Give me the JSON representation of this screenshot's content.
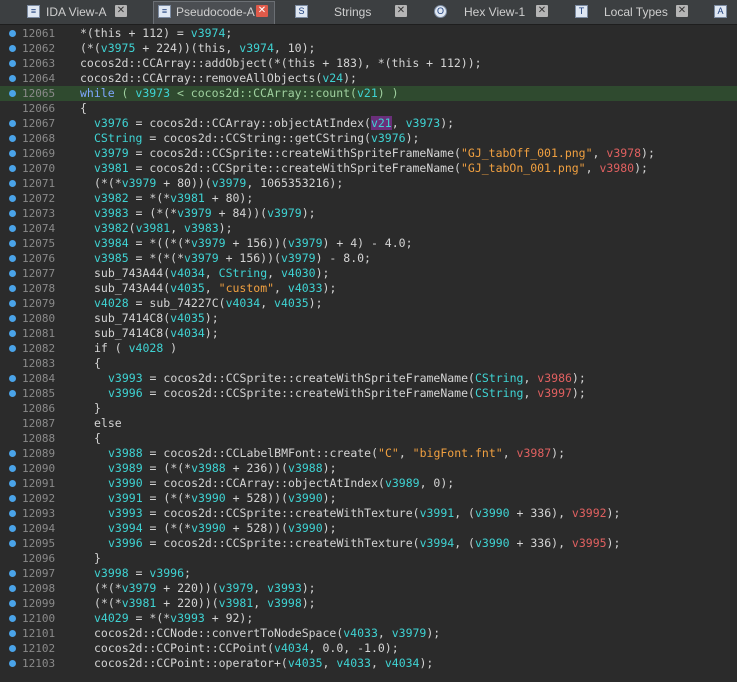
{
  "tabs": [
    {
      "label": "IDA View-A",
      "icon": "disassembly-view-icon",
      "active": false
    },
    {
      "label": "Pseudocode-A",
      "icon": "pseudocode-icon",
      "active": true
    },
    {
      "label": "Strings",
      "icon": "strings-icon",
      "active": false
    },
    {
      "label": "Hex View-1",
      "icon": "hex-view-icon",
      "active": false
    },
    {
      "label": "Local Types",
      "icon": "local-types-icon",
      "active": false
    }
  ],
  "colors": {
    "background": "#2b2b2b",
    "line_number": "#8a8a8a",
    "variable": "#3fd3d3",
    "string": "#f0a040",
    "red_variable": "#e06060",
    "highlight": "#2f4a2f",
    "breakpoint_dot": "#4aa3e8"
  },
  "code_lines": [
    {
      "num": "12061",
      "dot": true,
      "indent": 0,
      "tokens": [
        [
          "t",
          "*(this + 112) = "
        ],
        [
          "v",
          "v3974"
        ],
        [
          "t",
          ";"
        ]
      ]
    },
    {
      "num": "12062",
      "dot": true,
      "indent": 0,
      "tokens": [
        [
          "t",
          "(*("
        ],
        [
          "v",
          "v3975"
        ],
        [
          "t",
          " + 224))(this, "
        ],
        [
          "v",
          "v3974"
        ],
        [
          "t",
          ", 10);"
        ]
      ]
    },
    {
      "num": "12063",
      "dot": true,
      "indent": 0,
      "tokens": [
        [
          "t",
          "cocos2d::CCArray::addObject(*(this + 183), *(this + 112));"
        ]
      ]
    },
    {
      "num": "12064",
      "dot": true,
      "indent": 0,
      "tokens": [
        [
          "t",
          "cocos2d::CCArray::removeAllObjects("
        ],
        [
          "v",
          "v24"
        ],
        [
          "t",
          ");"
        ]
      ]
    },
    {
      "num": "12065",
      "dot": true,
      "indent": 0,
      "hl": true,
      "tokens": [
        [
          "k",
          "while"
        ],
        [
          "t",
          " ( "
        ],
        [
          "v",
          "v3973"
        ],
        [
          "t",
          " < cocos2d::CCArray::count("
        ],
        [
          "v",
          "v21"
        ],
        [
          "t",
          ") )"
        ]
      ]
    },
    {
      "num": "12066",
      "dot": false,
      "indent": 0,
      "tokens": [
        [
          "t",
          "{"
        ]
      ]
    },
    {
      "num": "12067",
      "dot": true,
      "indent": 1,
      "tokens": [
        [
          "v",
          "v3976"
        ],
        [
          "t",
          " = cocos2d::CCArray::objectAtIndex("
        ],
        [
          "sel",
          "v21"
        ],
        [
          "t",
          ", "
        ],
        [
          "v",
          "v3973"
        ],
        [
          "t",
          ");"
        ]
      ]
    },
    {
      "num": "12068",
      "dot": true,
      "indent": 1,
      "tokens": [
        [
          "v",
          "CString"
        ],
        [
          "t",
          " = cocos2d::CCString::getCString("
        ],
        [
          "v",
          "v3976"
        ],
        [
          "t",
          ");"
        ]
      ]
    },
    {
      "num": "12069",
      "dot": true,
      "indent": 1,
      "tokens": [
        [
          "v",
          "v3979"
        ],
        [
          "t",
          " = cocos2d::CCSprite::createWithSpriteFrameName("
        ],
        [
          "s",
          "\"GJ_tabOff_001.png\""
        ],
        [
          "t",
          ", "
        ],
        [
          "n",
          "v3978"
        ],
        [
          "t",
          ");"
        ]
      ]
    },
    {
      "num": "12070",
      "dot": true,
      "indent": 1,
      "tokens": [
        [
          "v",
          "v3981"
        ],
        [
          "t",
          " = cocos2d::CCSprite::createWithSpriteFrameName("
        ],
        [
          "s",
          "\"GJ_tabOn_001.png\""
        ],
        [
          "t",
          ", "
        ],
        [
          "n",
          "v3980"
        ],
        [
          "t",
          ");"
        ]
      ]
    },
    {
      "num": "12071",
      "dot": true,
      "indent": 1,
      "tokens": [
        [
          "t",
          "(*(*"
        ],
        [
          "v",
          "v3979"
        ],
        [
          "t",
          " + 80))("
        ],
        [
          "v",
          "v3979"
        ],
        [
          "t",
          ", 1065353216);"
        ]
      ]
    },
    {
      "num": "12072",
      "dot": true,
      "indent": 1,
      "tokens": [
        [
          "v",
          "v3982"
        ],
        [
          "t",
          " = *(*"
        ],
        [
          "v",
          "v3981"
        ],
        [
          "t",
          " + 80);"
        ]
      ]
    },
    {
      "num": "12073",
      "dot": true,
      "indent": 1,
      "tokens": [
        [
          "v",
          "v3983"
        ],
        [
          "t",
          " = (*(*"
        ],
        [
          "v",
          "v3979"
        ],
        [
          "t",
          " + 84))("
        ],
        [
          "v",
          "v3979"
        ],
        [
          "t",
          ");"
        ]
      ]
    },
    {
      "num": "12074",
      "dot": true,
      "indent": 1,
      "tokens": [
        [
          "v",
          "v3982"
        ],
        [
          "t",
          "("
        ],
        [
          "v",
          "v3981"
        ],
        [
          "t",
          ", "
        ],
        [
          "v",
          "v3983"
        ],
        [
          "t",
          ");"
        ]
      ]
    },
    {
      "num": "12075",
      "dot": true,
      "indent": 1,
      "tokens": [
        [
          "v",
          "v3984"
        ],
        [
          "t",
          " = *((*(*"
        ],
        [
          "v",
          "v3979"
        ],
        [
          "t",
          " + 156))("
        ],
        [
          "v",
          "v3979"
        ],
        [
          "t",
          ") + 4) - 4.0;"
        ]
      ]
    },
    {
      "num": "12076",
      "dot": true,
      "indent": 1,
      "tokens": [
        [
          "v",
          "v3985"
        ],
        [
          "t",
          " = *(*(*"
        ],
        [
          "v",
          "v3979"
        ],
        [
          "t",
          " + 156))("
        ],
        [
          "v",
          "v3979"
        ],
        [
          "t",
          ") - 8.0;"
        ]
      ]
    },
    {
      "num": "12077",
      "dot": true,
      "indent": 1,
      "tokens": [
        [
          "t",
          "sub_743A44("
        ],
        [
          "v",
          "v4034"
        ],
        [
          "t",
          ", "
        ],
        [
          "v",
          "CString"
        ],
        [
          "t",
          ", "
        ],
        [
          "v",
          "v4030"
        ],
        [
          "t",
          ");"
        ]
      ]
    },
    {
      "num": "12078",
      "dot": true,
      "indent": 1,
      "tokens": [
        [
          "t",
          "sub_743A44("
        ],
        [
          "v",
          "v4035"
        ],
        [
          "t",
          ", "
        ],
        [
          "s",
          "\"custom\""
        ],
        [
          "t",
          ", "
        ],
        [
          "v",
          "v4033"
        ],
        [
          "t",
          ");"
        ]
      ]
    },
    {
      "num": "12079",
      "dot": true,
      "indent": 1,
      "tokens": [
        [
          "v",
          "v4028"
        ],
        [
          "t",
          " = sub_74227C("
        ],
        [
          "v",
          "v4034"
        ],
        [
          "t",
          ", "
        ],
        [
          "v",
          "v4035"
        ],
        [
          "t",
          ");"
        ]
      ]
    },
    {
      "num": "12080",
      "dot": true,
      "indent": 1,
      "tokens": [
        [
          "t",
          "sub_7414C8("
        ],
        [
          "v",
          "v4035"
        ],
        [
          "t",
          ");"
        ]
      ]
    },
    {
      "num": "12081",
      "dot": true,
      "indent": 1,
      "tokens": [
        [
          "t",
          "sub_7414C8("
        ],
        [
          "v",
          "v4034"
        ],
        [
          "t",
          ");"
        ]
      ]
    },
    {
      "num": "12082",
      "dot": true,
      "indent": 1,
      "tokens": [
        [
          "t",
          "if ( "
        ],
        [
          "v",
          "v4028"
        ],
        [
          "t",
          " )"
        ]
      ]
    },
    {
      "num": "12083",
      "dot": false,
      "indent": 1,
      "tokens": [
        [
          "t",
          "{"
        ]
      ]
    },
    {
      "num": "12084",
      "dot": true,
      "indent": 2,
      "tokens": [
        [
          "v",
          "v3993"
        ],
        [
          "t",
          " = cocos2d::CCSprite::createWithSpriteFrameName("
        ],
        [
          "v",
          "CString"
        ],
        [
          "t",
          ", "
        ],
        [
          "n",
          "v3986"
        ],
        [
          "t",
          ");"
        ]
      ]
    },
    {
      "num": "12085",
      "dot": true,
      "indent": 2,
      "tokens": [
        [
          "v",
          "v3996"
        ],
        [
          "t",
          " = cocos2d::CCSprite::createWithSpriteFrameName("
        ],
        [
          "v",
          "CString"
        ],
        [
          "t",
          ", "
        ],
        [
          "n",
          "v3997"
        ],
        [
          "t",
          ");"
        ]
      ]
    },
    {
      "num": "12086",
      "dot": false,
      "indent": 1,
      "tokens": [
        [
          "t",
          "}"
        ]
      ]
    },
    {
      "num": "12087",
      "dot": false,
      "indent": 1,
      "tokens": [
        [
          "t",
          "else"
        ]
      ]
    },
    {
      "num": "12088",
      "dot": false,
      "indent": 1,
      "tokens": [
        [
          "t",
          "{"
        ]
      ]
    },
    {
      "num": "12089",
      "dot": true,
      "indent": 2,
      "tokens": [
        [
          "v",
          "v3988"
        ],
        [
          "t",
          " = cocos2d::CCLabelBMFont::create("
        ],
        [
          "s",
          "\"C\""
        ],
        [
          "t",
          ", "
        ],
        [
          "s",
          "\"bigFont.fnt\""
        ],
        [
          "t",
          ", "
        ],
        [
          "n",
          "v3987"
        ],
        [
          "t",
          ");"
        ]
      ]
    },
    {
      "num": "12090",
      "dot": true,
      "indent": 2,
      "tokens": [
        [
          "v",
          "v3989"
        ],
        [
          "t",
          " = (*(*"
        ],
        [
          "v",
          "v3988"
        ],
        [
          "t",
          " + 236))("
        ],
        [
          "v",
          "v3988"
        ],
        [
          "t",
          ");"
        ]
      ]
    },
    {
      "num": "12091",
      "dot": true,
      "indent": 2,
      "tokens": [
        [
          "v",
          "v3990"
        ],
        [
          "t",
          " = cocos2d::CCArray::objectAtIndex("
        ],
        [
          "v",
          "v3989"
        ],
        [
          "t",
          ", 0);"
        ]
      ]
    },
    {
      "num": "12092",
      "dot": true,
      "indent": 2,
      "tokens": [
        [
          "v",
          "v3991"
        ],
        [
          "t",
          " = (*(*"
        ],
        [
          "v",
          "v3990"
        ],
        [
          "t",
          " + 528))("
        ],
        [
          "v",
          "v3990"
        ],
        [
          "t",
          ");"
        ]
      ]
    },
    {
      "num": "12093",
      "dot": true,
      "indent": 2,
      "tokens": [
        [
          "v",
          "v3993"
        ],
        [
          "t",
          " = cocos2d::CCSprite::createWithTexture("
        ],
        [
          "v",
          "v3991"
        ],
        [
          "t",
          ", ("
        ],
        [
          "v",
          "v3990"
        ],
        [
          "t",
          " + 336), "
        ],
        [
          "n",
          "v3992"
        ],
        [
          "t",
          ");"
        ]
      ]
    },
    {
      "num": "12094",
      "dot": true,
      "indent": 2,
      "tokens": [
        [
          "v",
          "v3994"
        ],
        [
          "t",
          " = (*(*"
        ],
        [
          "v",
          "v3990"
        ],
        [
          "t",
          " + 528))("
        ],
        [
          "v",
          "v3990"
        ],
        [
          "t",
          ");"
        ]
      ]
    },
    {
      "num": "12095",
      "dot": true,
      "indent": 2,
      "tokens": [
        [
          "v",
          "v3996"
        ],
        [
          "t",
          " = cocos2d::CCSprite::createWithTexture("
        ],
        [
          "v",
          "v3994"
        ],
        [
          "t",
          ", ("
        ],
        [
          "v",
          "v3990"
        ],
        [
          "t",
          " + 336), "
        ],
        [
          "n",
          "v3995"
        ],
        [
          "t",
          ");"
        ]
      ]
    },
    {
      "num": "12096",
      "dot": false,
      "indent": 1,
      "tokens": [
        [
          "t",
          "}"
        ]
      ]
    },
    {
      "num": "12097",
      "dot": true,
      "indent": 1,
      "tokens": [
        [
          "v",
          "v3998"
        ],
        [
          "t",
          " = "
        ],
        [
          "v",
          "v3996"
        ],
        [
          "t",
          ";"
        ]
      ]
    },
    {
      "num": "12098",
      "dot": true,
      "indent": 1,
      "tokens": [
        [
          "t",
          "(*(*"
        ],
        [
          "v",
          "v3979"
        ],
        [
          "t",
          " + 220))("
        ],
        [
          "v",
          "v3979"
        ],
        [
          "t",
          ", "
        ],
        [
          "v",
          "v3993"
        ],
        [
          "t",
          ");"
        ]
      ]
    },
    {
      "num": "12099",
      "dot": true,
      "indent": 1,
      "tokens": [
        [
          "t",
          "(*(*"
        ],
        [
          "v",
          "v3981"
        ],
        [
          "t",
          " + 220))("
        ],
        [
          "v",
          "v3981"
        ],
        [
          "t",
          ", "
        ],
        [
          "v",
          "v3998"
        ],
        [
          "t",
          ");"
        ]
      ]
    },
    {
      "num": "12100",
      "dot": true,
      "indent": 1,
      "tokens": [
        [
          "v",
          "v4029"
        ],
        [
          "t",
          " = *(*"
        ],
        [
          "v",
          "v3993"
        ],
        [
          "t",
          " + 92);"
        ]
      ]
    },
    {
      "num": "12101",
      "dot": true,
      "indent": 1,
      "tokens": [
        [
          "t",
          "cocos2d::CCNode::convertToNodeSpace("
        ],
        [
          "v",
          "v4033"
        ],
        [
          "t",
          ", "
        ],
        [
          "v",
          "v3979"
        ],
        [
          "t",
          ");"
        ]
      ]
    },
    {
      "num": "12102",
      "dot": true,
      "indent": 1,
      "tokens": [
        [
          "t",
          "cocos2d::CCPoint::CCPoint("
        ],
        [
          "v",
          "v4034"
        ],
        [
          "t",
          ", 0.0, -1.0);"
        ]
      ]
    },
    {
      "num": "12103",
      "dot": true,
      "indent": 1,
      "tokens": [
        [
          "t",
          "cocos2d::CCPoint::operator+("
        ],
        [
          "v",
          "v4035"
        ],
        [
          "t",
          ", "
        ],
        [
          "v",
          "v4033"
        ],
        [
          "t",
          ", "
        ],
        [
          "v",
          "v4034"
        ],
        [
          "t",
          ");"
        ]
      ]
    }
  ]
}
